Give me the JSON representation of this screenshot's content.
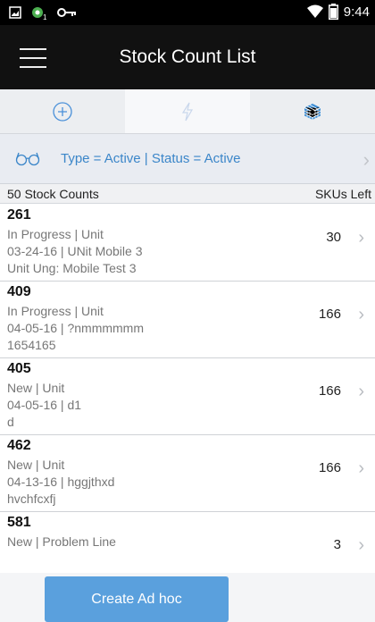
{
  "status_bar": {
    "time": "9:44"
  },
  "app_bar": {
    "title": "Stock Count List"
  },
  "tabs": [
    {
      "name": "add",
      "icon": "plus-circle-icon"
    },
    {
      "name": "flash",
      "icon": "lightning-icon"
    },
    {
      "name": "cube",
      "icon": "cube-icon"
    }
  ],
  "filter": {
    "text": "Type = Active | Status = Active"
  },
  "list_header": {
    "count_label": "50 Stock Counts",
    "skus_label": "SKUs Left"
  },
  "items": [
    {
      "id": "261",
      "status": "In Progress | Unit",
      "date_desc": "03-24-16 | UNit Mobile 3",
      "extra": "Unit Ung: Mobile Test 3",
      "skus_left": "30"
    },
    {
      "id": "409",
      "status": "In Progress | Unit",
      "date_desc": "04-05-16 | ?nmmmmmm",
      "extra": "1654165",
      "skus_left": "166"
    },
    {
      "id": "405",
      "status": "New | Unit",
      "date_desc": "04-05-16 | d1",
      "extra": "d",
      "skus_left": "166"
    },
    {
      "id": "462",
      "status": "New | Unit",
      "date_desc": "04-13-16 | hggjthxd",
      "extra": "hvchfcxfj",
      "skus_left": "166"
    },
    {
      "id": "581",
      "status": "New | Problem Line",
      "date_desc": "",
      "extra": "",
      "skus_left": "3"
    }
  ],
  "bottom": {
    "create_label": "Create Ad hoc"
  },
  "colors": {
    "accent": "#3b86c9",
    "button": "#5aa0dd",
    "app_bar": "#111111"
  }
}
